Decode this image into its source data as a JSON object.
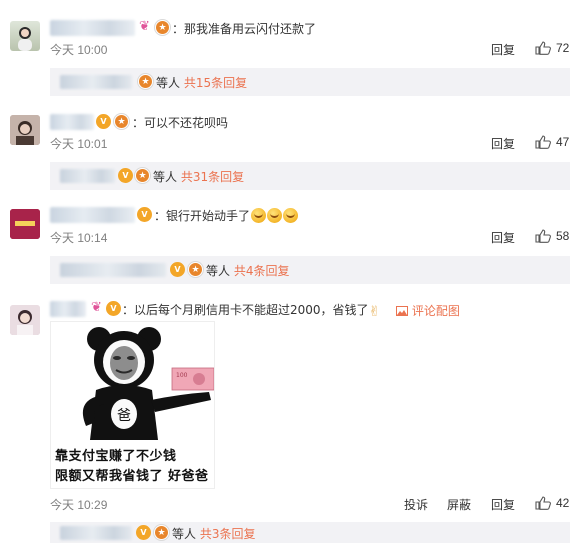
{
  "comments": [
    {
      "text": "：那我准备用云闪付还款了",
      "time": "今天 10:00",
      "actions": [
        "回复"
      ],
      "likes": "72",
      "replies": {
        "suffix": "等人",
        "link": "共15条回复"
      }
    },
    {
      "text": "：可以不还花呗吗",
      "time": "今天 10:01",
      "actions": [
        "回复"
      ],
      "likes": "47",
      "replies": {
        "suffix": "等人",
        "link": "共31条回复"
      }
    },
    {
      "text": "：银行开始动手了",
      "time": "今天 10:14",
      "actions": [
        "回复"
      ],
      "likes": "58",
      "replies": {
        "suffix": "等人",
        "link": "共4条回复"
      }
    },
    {
      "text": "：以后每个月刷信用卡不能超过2000，省钱了",
      "pic_link": "评论配图",
      "time": "今天 10:29",
      "actions": [
        "投诉",
        "屏蔽",
        "回复"
      ],
      "likes": "42",
      "meme": {
        "line1": "靠支付宝赚了不少钱",
        "line2": "限额又帮我省钱了 好爸爸",
        "belly": "爸",
        "banknote": "100"
      },
      "replies": {
        "suffix": "等人",
        "link": "共3条回复"
      }
    }
  ],
  "colors": {
    "link": "#eb7350",
    "reply_bg": "#f2f2f5",
    "time": "#808080"
  },
  "icons": [
    "thumb-up-icon",
    "image-icon",
    "bow-badge-icon",
    "vip-badge-icon",
    "medal-badge-icon"
  ]
}
